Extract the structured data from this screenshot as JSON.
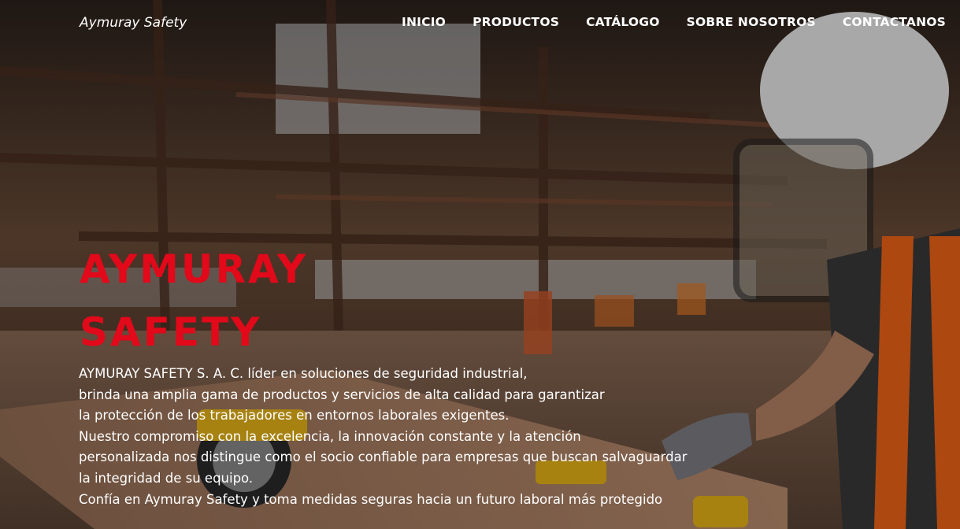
{
  "nav": {
    "brand": "Aymuray Safety",
    "items": [
      {
        "label": "INICIO"
      },
      {
        "label": "PRODUCTOS"
      },
      {
        "label": "CATÁLOGO"
      },
      {
        "label": "SOBRE NOSOTROS"
      },
      {
        "label": "CONTACTANOS"
      }
    ]
  },
  "hero": {
    "title_line1": "AYMURAY",
    "title_line2": "SAFETY",
    "description_lines": [
      "AYMURAY SAFETY S. A. C. líder en soluciones de seguridad industrial,",
      "brinda una amplia gama de productos y servicios de alta calidad para garantizar",
      "la protección de los trabajadores en entornos laborales exigentes.",
      "Nuestro compromiso con la excelencia, la innovación constante y la atención",
      "personalizada nos distingue como el socio confiable para empresas que buscan salvaguardar",
      "la integridad de su equipo.",
      "Confía en Aymuray Safety y toma medidas seguras hacia un futuro laboral más protegido"
    ]
  },
  "colors": {
    "accent": "#e1091a",
    "text": "#ffffff"
  }
}
